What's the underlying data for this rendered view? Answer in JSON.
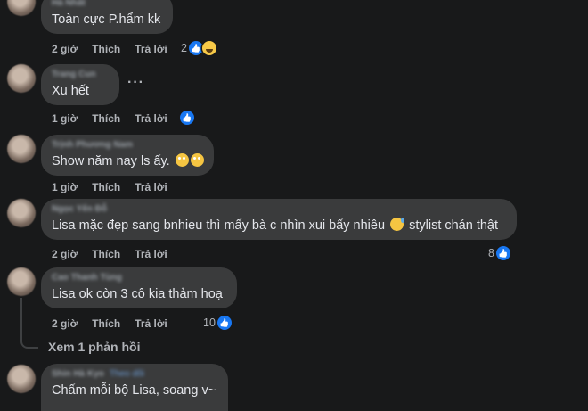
{
  "comments": [
    {
      "author": "Hà Nhất",
      "text": "Toàn cực P.hẩm kk",
      "time": "2 giờ",
      "like_label": "Thích",
      "reply_label": "Trả lời",
      "reaction_count": "2",
      "reactions": [
        "like-icon",
        "haha-icon"
      ]
    },
    {
      "author": "Trang Cun",
      "text": "Xu hết",
      "time": "1 giờ",
      "like_label": "Thích",
      "reply_label": "Trả lời",
      "reaction_count": "",
      "reactions": [
        "like-icon"
      ],
      "more_menu": "···"
    },
    {
      "author": "Trịnh Phương Nam",
      "text": "Show năm nay ls ấy.",
      "emoji": [
        "eye-roll-emoji",
        "eye-roll-emoji"
      ],
      "time": "1 giờ",
      "like_label": "Thích",
      "reply_label": "Trả lời"
    },
    {
      "author": "Ngọc Yến Đỗ",
      "text_before": "Lisa mặc đẹp sang bnhieu thì mấy bà c nhìn xui bấy nhiêu",
      "emoji": "sweat-smile-emoji",
      "text_after": "stylist chán thật",
      "time": "2 giờ",
      "like_label": "Thích",
      "reply_label": "Trả lời",
      "reaction_count": "8",
      "reactions": [
        "like-icon"
      ]
    },
    {
      "author": "Cao Thanh Tùng",
      "text": "Lisa ok còn 3 cô kia thảm hoạ",
      "time": "2 giờ",
      "like_label": "Thích",
      "reply_label": "Trả lời",
      "reaction_count": "10",
      "reactions": [
        "like-icon"
      ],
      "view_replies": "Xem 1 phản hồi"
    },
    {
      "author": "Shin Hà Kyo",
      "follow_label": "Theo dõi",
      "text": "Chấm mỗi bộ Lisa, soang v~"
    }
  ],
  "colors": {
    "background": "#18191a",
    "bubble": "#3a3b3c",
    "text": "#e4e6eb",
    "secondary": "#b0b3b8",
    "like_blue": "#1877f2"
  }
}
